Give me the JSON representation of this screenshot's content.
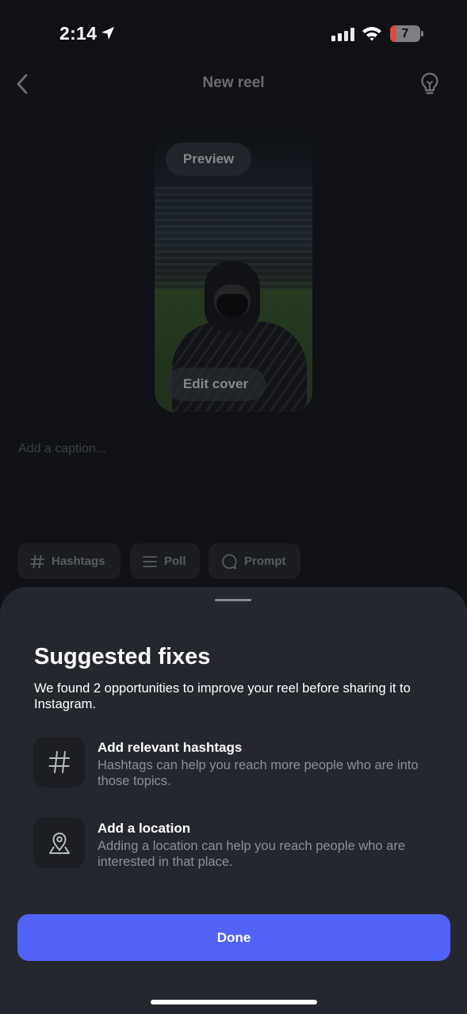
{
  "status_bar": {
    "time": "2:14",
    "battery_level": "7",
    "icons": [
      "location-arrow-icon",
      "cellular-signal-icon",
      "wifi-icon",
      "battery-icon"
    ]
  },
  "header": {
    "title": "New reel",
    "left_icon": "back-chevron-icon",
    "right_icon": "lightbulb-icon"
  },
  "preview": {
    "preview_label": "Preview",
    "edit_cover_label": "Edit cover"
  },
  "caption": {
    "placeholder": "Add a caption..."
  },
  "chips": [
    {
      "label": "Hashtags",
      "icon": "hashtag-icon"
    },
    {
      "label": "Poll",
      "icon": "poll-lines-icon"
    },
    {
      "label": "Prompt",
      "icon": "prompt-bubble-icon"
    }
  ],
  "sheet": {
    "title": "Suggested fixes",
    "description": "We found 2 opportunities to improve your reel before sharing it to Instagram.",
    "fixes": [
      {
        "title": "Add relevant hashtags",
        "description": "Hashtags can help you reach more people who are into those topics.",
        "icon": "hashtag-icon"
      },
      {
        "title": "Add a location",
        "description": "Adding a location can help you reach people who are interested in that place.",
        "icon": "location-pin-icon"
      }
    ],
    "done_label": "Done"
  },
  "colors": {
    "background": "#0f1116",
    "sheet": "#25272e",
    "accent": "#5163f6"
  }
}
